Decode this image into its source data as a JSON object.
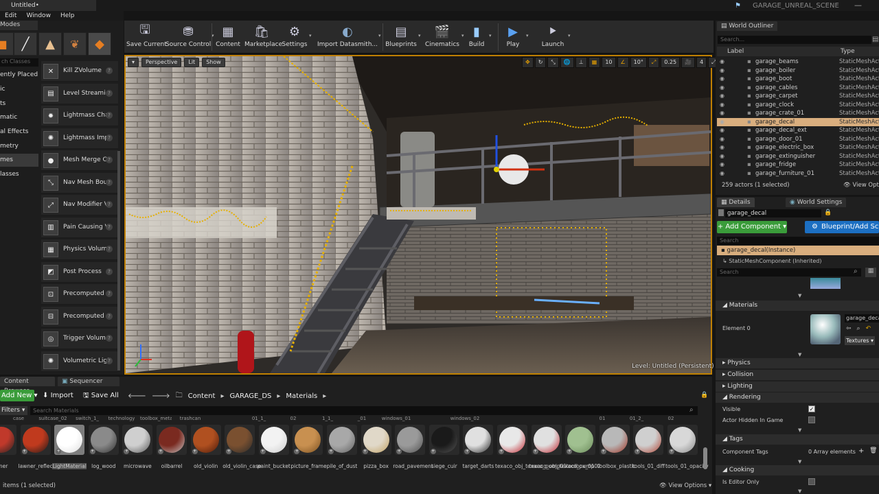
{
  "title_bar": {
    "doc_tab": "Untitled•",
    "scene_name": "GARAGE_UNREAL_SCENE"
  },
  "menu": [
    "Edit",
    "Window",
    "Help"
  ],
  "modes": {
    "tab": "Modes",
    "search_placeholder": "ch Classes",
    "categories": [
      "ently Placed",
      "ic",
      "ts",
      "matic",
      "al Effects",
      "metry",
      "mes",
      "lasses"
    ],
    "selected_category_index": 6,
    "items": [
      {
        "label": "Kill ZVolume",
        "icon": "kill-volume-icon"
      },
      {
        "label": "Level Streami",
        "icon": "level-streaming-icon"
      },
      {
        "label": "Lightmass Cha",
        "icon": "lightmass-character-icon"
      },
      {
        "label": "Lightmass Imp",
        "icon": "lightmass-importance-icon"
      },
      {
        "label": "Mesh Merge Culli",
        "icon": "mesh-merge-icon"
      },
      {
        "label": "Nav Mesh Bou",
        "icon": "nav-mesh-icon"
      },
      {
        "label": "Nav Modifier V",
        "icon": "nav-modifier-icon"
      },
      {
        "label": "Pain Causing V",
        "icon": "pain-volume-icon"
      },
      {
        "label": "Physics Volum",
        "icon": "physics-volume-icon"
      },
      {
        "label": "Post Process",
        "icon": "post-process-icon"
      },
      {
        "label": "Precomputed",
        "icon": "precomputed-visibility-icon"
      },
      {
        "label": "Precomputed",
        "icon": "precomputed-override-icon"
      },
      {
        "label": "Trigger Volum",
        "icon": "trigger-volume-icon"
      },
      {
        "label": "Volumetric Lightn",
        "icon": "volumetric-lightmap-icon"
      }
    ]
  },
  "toolbar": [
    {
      "label": "Save Current",
      "icon": "save-icon",
      "dd": false
    },
    {
      "label": "Source Control",
      "icon": "source-control-icon",
      "dd": true
    },
    {
      "label": "Content",
      "icon": "content-icon",
      "dd": false
    },
    {
      "label": "Marketplace",
      "icon": "marketplace-icon",
      "dd": false
    },
    {
      "label": "Settings",
      "icon": "settings-icon",
      "dd": true
    },
    {
      "label": "Import Datasmith...",
      "icon": "datasmith-icon",
      "dd": true
    },
    {
      "label": "Blueprints",
      "icon": "blueprints-icon",
      "dd": true
    },
    {
      "label": "Cinematics",
      "icon": "cinematics-icon",
      "dd": true
    },
    {
      "label": "Build",
      "icon": "build-icon",
      "dd": true
    },
    {
      "label": "Play",
      "icon": "play-icon",
      "dd": true
    },
    {
      "label": "Launch",
      "icon": "launch-icon",
      "dd": true
    }
  ],
  "viewport": {
    "perspective": "Perspective",
    "lit": "Lit",
    "show": "Show",
    "grid_snap": "10",
    "rot_snap": "10°",
    "scale_snap": "0.25",
    "cam_speed": "4",
    "level": "Level: Untitled (Persistent)"
  },
  "outliner": {
    "tab": "World Outliner",
    "search_placeholder": "Search...",
    "col_label": "Label",
    "col_type": "Type",
    "rows": [
      {
        "label": "garage_beams",
        "type": "StaticMeshActo"
      },
      {
        "label": "garage_boiler",
        "type": "StaticMeshActo"
      },
      {
        "label": "garage_boot",
        "type": "StaticMeshActo"
      },
      {
        "label": "garage_cables",
        "type": "StaticMeshActo"
      },
      {
        "label": "garage_carpet",
        "type": "StaticMeshActo"
      },
      {
        "label": "garage_clock",
        "type": "StaticMeshActo"
      },
      {
        "label": "garage_crate_01",
        "type": "StaticMeshActo"
      },
      {
        "label": "garage_decal",
        "type": "StaticMeshActo"
      },
      {
        "label": "garage_decal_ext",
        "type": "StaticMeshActo"
      },
      {
        "label": "garage_door_01",
        "type": "StaticMeshActo"
      },
      {
        "label": "garage_electric_box",
        "type": "StaticMeshActo"
      },
      {
        "label": "garage_extinguisher",
        "type": "StaticMeshActo"
      },
      {
        "label": "garage_fridge",
        "type": "StaticMeshActo"
      },
      {
        "label": "garage_furniture_01",
        "type": "StaticMeshActo"
      }
    ],
    "selected_index": 7,
    "status": "259 actors (1 selected)",
    "view_options": "View Options"
  },
  "details": {
    "tab_details": "Details",
    "tab_world": "World Settings",
    "name": "garage_decal",
    "add_component": "+ Add Component ▾",
    "blueprint": "Blueprint/Add Scri",
    "search_placeholder": "Search",
    "instance": "garage_decal(Instance)",
    "component": "StaticMeshComponent (Inherited)",
    "search2_placeholder": "Search",
    "materials_section": "Materials",
    "element_label": "Element 0",
    "material_name": "garage_decal",
    "textures_btn": "Textures ▾",
    "physics": "Physics",
    "collision": "Collision",
    "lighting": "Lighting",
    "rendering": "Rendering",
    "visible": "Visible",
    "actor_hidden": "Actor Hidden In Game",
    "tags": "Tags",
    "component_tags": "Component Tags",
    "array": "0 Array elements",
    "cooking": "Cooking",
    "editor_only": "Is Editor Only"
  },
  "content_browser": {
    "tab_cb": "Content Browser",
    "tab_seq": "Sequencer",
    "add_new": "Add New ▾",
    "import": "Import",
    "save_all": "Save All",
    "path": [
      "Content",
      "GARAGE_DS",
      "Materials"
    ],
    "filters": "Filters ▾",
    "search_placeholder": "Search Materials",
    "top_labels": [
      "case",
      "suitcase_02",
      "switch_1_",
      "technology",
      "toolbox_metal",
      "trashcan",
      "",
      "01_1_",
      "02",
      "1_1_",
      "_01",
      "windows_01",
      "",
      "windows_02",
      "",
      "",
      "",
      "01",
      "01_2_",
      "02"
    ],
    "assets": [
      {
        "label": "wner",
        "color": "#c0392b",
        "accent": "#222"
      },
      {
        "label": "lawner_reflect",
        "color": "#c03a1e",
        "accent": "#1a1a1a"
      },
      {
        "label": "LightMaterial",
        "color": "#ffffff",
        "accent": "#dddddd"
      },
      {
        "label": "log_wood",
        "color": "#8a8a8a",
        "accent": "#303030"
      },
      {
        "label": "microwave",
        "color": "#cfcfcf",
        "accent": "#555"
      },
      {
        "label": "oilbarrel",
        "color": "#7a2a20",
        "accent": "#c7c7c7"
      },
      {
        "label": "old_violin",
        "color": "#b05020",
        "accent": "#4a1a0a"
      },
      {
        "label": "old_violin_case",
        "color": "#7a5030",
        "accent": "#2a2a2a"
      },
      {
        "label": "paint_bucket",
        "color": "#f2f2f2",
        "accent": "#cccccc"
      },
      {
        "label": "picture_frame",
        "color": "#c89050",
        "accent": "#7a5020"
      },
      {
        "label": "pile_of_dust",
        "color": "#a8a8a8",
        "accent": "#606060"
      },
      {
        "label": "pizza_box",
        "color": "#e0d8c8",
        "accent": "#c0a060"
      },
      {
        "label": "road_pavement",
        "color": "#9a9a9a",
        "accent": "#505050"
      },
      {
        "label": "siege_cuir",
        "color": "#1a1a1a",
        "accent": "#555"
      },
      {
        "label": "target_darts",
        "color": "#e0e0e0",
        "accent": "#222"
      },
      {
        "label": "texaco_obj_texaco_pump01",
        "color": "#e8e8e8",
        "accent": "#c0202a"
      },
      {
        "label": "texaco_obj_texaco_pump02",
        "color": "#e0e0e0",
        "accent": "#c0202a"
      },
      {
        "label": "toolbox_01",
        "color": "#a0c090",
        "accent": "#6a8a5a"
      },
      {
        "label": "toolbox_plastic",
        "color": "#b8b8b8",
        "accent": "#a03020"
      },
      {
        "label": "tools_01_diff",
        "color": "#cfcfcf",
        "accent": "#b04030"
      },
      {
        "label": "tools_01_opacity",
        "color": "#d8d8d8",
        "accent": "#888"
      }
    ],
    "selected_asset": 2,
    "status": "items (1 selected)",
    "view_options": "View Options ▾"
  }
}
